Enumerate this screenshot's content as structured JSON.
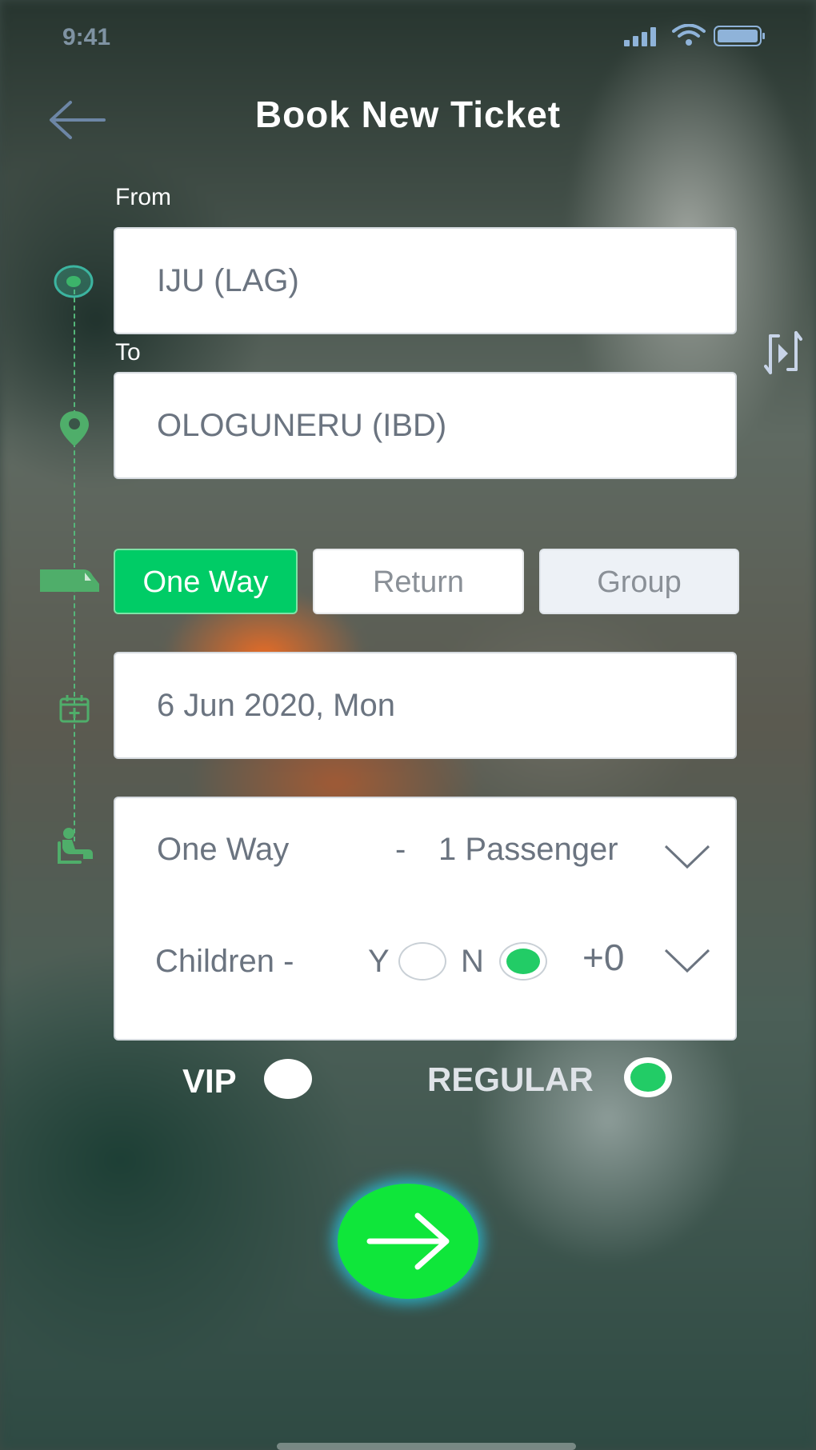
{
  "status_bar": {
    "time": "9:41"
  },
  "header": {
    "title": "Book New Ticket"
  },
  "route": {
    "from_label": "From",
    "from_value": "IJU (LAG)",
    "to_label": "To",
    "to_value": "OLOGUNERU (IBD)"
  },
  "trip_types": {
    "one_way": "One Way",
    "return": "Return",
    "group": "Group",
    "selected": "One Way"
  },
  "date": {
    "value": "6 Jun 2020, Mon"
  },
  "passengers": {
    "trip": "One Way",
    "separator": "-",
    "count": "1 Passenger",
    "children_label": "Children -",
    "yes_label": "Y",
    "no_label": "N",
    "children_selected": "N",
    "children_count": "+0"
  },
  "ticket_class": {
    "vip_label": "VIP",
    "regular_label": "REGULAR",
    "selected": "REGULAR"
  },
  "colors": {
    "accent": "#00cc66",
    "go_button": "#0fe63a",
    "timeline": "#55b77a"
  },
  "icons": [
    "back-arrow-icon",
    "signal-icon",
    "wifi-icon",
    "battery-icon",
    "swap-icon",
    "origin-marker-icon",
    "destination-pin-icon",
    "bus-icon",
    "calendar-add-icon",
    "seated-passenger-icon",
    "chevron-down-icon",
    "arrow-right-icon"
  ]
}
